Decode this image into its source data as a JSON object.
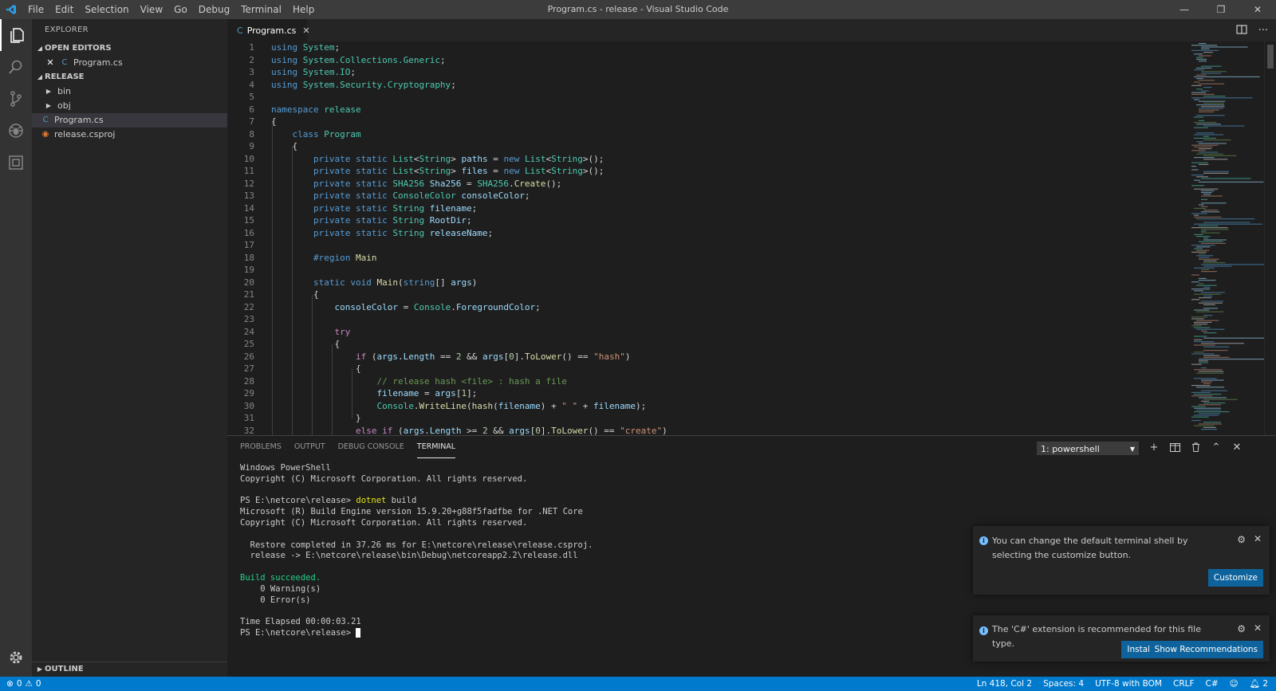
{
  "window": {
    "title": "Program.cs - release - Visual Studio Code"
  },
  "menu": [
    "File",
    "Edit",
    "Selection",
    "View",
    "Go",
    "Debug",
    "Terminal",
    "Help"
  ],
  "sidebar": {
    "title": "EXPLORER",
    "open_editors_label": "OPEN EDITORS",
    "open_editor_file": "Program.cs",
    "folder_label": "RELEASE",
    "items": [
      {
        "label": "bin",
        "type": "folder"
      },
      {
        "label": "obj",
        "type": "folder"
      },
      {
        "label": "Program.cs",
        "type": "cs"
      },
      {
        "label": "release.csproj",
        "type": "rss"
      }
    ],
    "outline_label": "OUTLINE"
  },
  "editor": {
    "tab_label": "Program.cs",
    "line_numbers": [
      "1",
      "2",
      "3",
      "4",
      "5",
      "6",
      "7",
      "8",
      "9",
      "10",
      "11",
      "12",
      "13",
      "14",
      "15",
      "16",
      "17",
      "18",
      "19",
      "20",
      "21",
      "22",
      "23",
      "24",
      "25",
      "26",
      "27",
      "28",
      "29",
      "30",
      "31",
      "32"
    ],
    "code_lines": [
      [
        [
          "kw",
          "using "
        ],
        [
          "ty",
          "System"
        ],
        [
          "",
          "; "
        ]
      ],
      [
        [
          "kw",
          "using "
        ],
        [
          "ty",
          "System.Collections.Generic"
        ],
        [
          "",
          ";"
        ]
      ],
      [
        [
          "kw",
          "using "
        ],
        [
          "ty",
          "System.IO"
        ],
        [
          "",
          ";"
        ]
      ],
      [
        [
          "kw",
          "using "
        ],
        [
          "ty",
          "System.Security.Cryptography"
        ],
        [
          "",
          ";"
        ]
      ],
      [],
      [
        [
          "kw",
          "namespace "
        ],
        [
          "ty",
          "release"
        ]
      ],
      [
        [
          "",
          "{"
        ]
      ],
      [
        [
          "",
          "    "
        ],
        [
          "kw",
          "class "
        ],
        [
          "ty",
          "Program"
        ]
      ],
      [
        [
          "",
          "    {"
        ]
      ],
      [
        [
          "",
          "        "
        ],
        [
          "kw",
          "private static "
        ],
        [
          "ty",
          "List"
        ],
        [
          "",
          "<"
        ],
        [
          "ty",
          "String"
        ],
        [
          "",
          "> "
        ],
        [
          "vr",
          "paths"
        ],
        [
          "",
          " = "
        ],
        [
          "kw",
          "new "
        ],
        [
          "ty",
          "List"
        ],
        [
          "",
          "<"
        ],
        [
          "ty",
          "String"
        ],
        [
          "",
          ">();"
        ]
      ],
      [
        [
          "",
          "        "
        ],
        [
          "kw",
          "private static "
        ],
        [
          "ty",
          "List"
        ],
        [
          "",
          "<"
        ],
        [
          "ty",
          "String"
        ],
        [
          "",
          "> "
        ],
        [
          "vr",
          "files"
        ],
        [
          "",
          " = "
        ],
        [
          "kw",
          "new "
        ],
        [
          "ty",
          "List"
        ],
        [
          "",
          "<"
        ],
        [
          "ty",
          "String"
        ],
        [
          "",
          ">();"
        ]
      ],
      [
        [
          "",
          "        "
        ],
        [
          "kw",
          "private static "
        ],
        [
          "ty",
          "SHA256 "
        ],
        [
          "vr",
          "Sha256"
        ],
        [
          "",
          " = "
        ],
        [
          "ty",
          "SHA256"
        ],
        [
          "",
          "."
        ],
        [
          "fn",
          "Create"
        ],
        [
          "",
          "();"
        ]
      ],
      [
        [
          "",
          "        "
        ],
        [
          "kw",
          "private static "
        ],
        [
          "ty",
          "ConsoleColor "
        ],
        [
          "vr",
          "consoleColor"
        ],
        [
          "",
          ";"
        ]
      ],
      [
        [
          "",
          "        "
        ],
        [
          "kw",
          "private static "
        ],
        [
          "ty",
          "String "
        ],
        [
          "vr",
          "filename"
        ],
        [
          "",
          ";"
        ]
      ],
      [
        [
          "",
          "        "
        ],
        [
          "kw",
          "private static "
        ],
        [
          "ty",
          "String "
        ],
        [
          "vr",
          "RootDir"
        ],
        [
          "",
          ";"
        ]
      ],
      [
        [
          "",
          "        "
        ],
        [
          "kw",
          "private static "
        ],
        [
          "ty",
          "String "
        ],
        [
          "vr",
          "releaseName"
        ],
        [
          "",
          ";"
        ]
      ],
      [],
      [
        [
          "",
          "        "
        ],
        [
          "kw",
          "#region "
        ],
        [
          "fn",
          "Main"
        ]
      ],
      [],
      [
        [
          "",
          "        "
        ],
        [
          "kw",
          "static void "
        ],
        [
          "fn",
          "Main"
        ],
        [
          "",
          "("
        ],
        [
          "kw",
          "string"
        ],
        [
          "",
          "[] "
        ],
        [
          "vr",
          "args"
        ],
        [
          "",
          ")"
        ]
      ],
      [
        [
          "",
          "        {"
        ]
      ],
      [
        [
          "",
          "            "
        ],
        [
          "vr",
          "consoleColor"
        ],
        [
          "",
          " = "
        ],
        [
          "ty",
          "Console"
        ],
        [
          "",
          "."
        ],
        [
          "vr",
          "ForegroundColor"
        ],
        [
          "",
          ";"
        ]
      ],
      [],
      [
        [
          "",
          "            "
        ],
        [
          "ct",
          "try"
        ]
      ],
      [
        [
          "",
          "            {"
        ]
      ],
      [
        [
          "",
          "                "
        ],
        [
          "ct",
          "if "
        ],
        [
          "",
          "("
        ],
        [
          "vr",
          "args"
        ],
        [
          "",
          "."
        ],
        [
          "vr",
          "Length"
        ],
        [
          "",
          " == "
        ],
        [
          "nu",
          "2"
        ],
        [
          "",
          " && "
        ],
        [
          "vr",
          "args"
        ],
        [
          "",
          "["
        ],
        [
          "nu",
          "0"
        ],
        [
          "",
          "]."
        ],
        [
          "fn",
          "ToLower"
        ],
        [
          "",
          "() == "
        ],
        [
          "st",
          "\"hash\""
        ],
        [
          "",
          ")"
        ]
      ],
      [
        [
          "",
          "                {"
        ]
      ],
      [
        [
          "",
          "                    "
        ],
        [
          "cm",
          "// release hash <file> : hash a file"
        ]
      ],
      [
        [
          "",
          "                    "
        ],
        [
          "vr",
          "filename"
        ],
        [
          "",
          " = "
        ],
        [
          "vr",
          "args"
        ],
        [
          "",
          "["
        ],
        [
          "nu",
          "1"
        ],
        [
          "",
          "];"
        ]
      ],
      [
        [
          "",
          "                    "
        ],
        [
          "ty",
          "Console"
        ],
        [
          "",
          "."
        ],
        [
          "fn",
          "WriteLine"
        ],
        [
          "",
          "("
        ],
        [
          "fn",
          "hash"
        ],
        [
          "",
          "("
        ],
        [
          "vr",
          "filename"
        ],
        [
          "",
          ") + "
        ],
        [
          "st",
          "\" \""
        ],
        [
          "",
          " + "
        ],
        [
          "vr",
          "filename"
        ],
        [
          "",
          ");"
        ]
      ],
      [
        [
          "",
          "                }"
        ]
      ],
      [
        [
          "",
          "                "
        ],
        [
          "ct",
          "else if "
        ],
        [
          "",
          "("
        ],
        [
          "vr",
          "args"
        ],
        [
          "",
          "."
        ],
        [
          "vr",
          "Length"
        ],
        [
          "",
          " >= "
        ],
        [
          "nu",
          "2"
        ],
        [
          "",
          " && "
        ],
        [
          "vr",
          "args"
        ],
        [
          "",
          "["
        ],
        [
          "nu",
          "0"
        ],
        [
          "",
          "]."
        ],
        [
          "fn",
          "ToLower"
        ],
        [
          "",
          "() == "
        ],
        [
          "st",
          "\"create\""
        ],
        [
          "",
          ")"
        ]
      ]
    ]
  },
  "panel": {
    "tabs": [
      "PROBLEMS",
      "OUTPUT",
      "DEBUG CONSOLE",
      "TERMINAL"
    ],
    "active_tab": "TERMINAL",
    "terminal_select": "1: powershell",
    "terminal_lines": [
      [
        [
          "",
          "Windows PowerShell"
        ]
      ],
      [
        [
          "",
          "Copyright (C) Microsoft Corporation. All rights reserved."
        ]
      ],
      [
        [
          "",
          ""
        ]
      ],
      [
        [
          "",
          "PS E:\\netcore\\release> "
        ],
        [
          "yl",
          "dotnet"
        ],
        [
          "",
          " build"
        ]
      ],
      [
        [
          "",
          "Microsoft (R) Build Engine version 15.9.20+g88f5fadfbe for .NET Core"
        ]
      ],
      [
        [
          "",
          "Copyright (C) Microsoft Corporation. All rights reserved."
        ]
      ],
      [
        [
          "",
          ""
        ]
      ],
      [
        [
          "",
          "  Restore completed in 37.26 ms for E:\\netcore\\release\\release.csproj."
        ]
      ],
      [
        [
          "",
          "  release -> E:\\netcore\\release\\bin\\Debug\\netcoreapp2.2\\release.dll"
        ]
      ],
      [
        [
          "",
          ""
        ]
      ],
      [
        [
          "gr",
          "Build succeeded."
        ]
      ],
      [
        [
          "",
          "    0 Warning(s)"
        ]
      ],
      [
        [
          "",
          "    0 Error(s)"
        ]
      ],
      [
        [
          "",
          ""
        ]
      ],
      [
        [
          "",
          "Time Elapsed 00:00:03.21"
        ]
      ],
      [
        [
          "",
          "PS E:\\netcore\\release> "
        ]
      ]
    ]
  },
  "notifications": [
    {
      "message": "You can change the default terminal shell by selecting the customize button.",
      "buttons": [
        "Customize"
      ]
    },
    {
      "message": "The 'C#' extension is recommended for this file type.",
      "buttons": [
        "Install",
        "Show Recommendations"
      ]
    }
  ],
  "statusbar": {
    "errors": "0",
    "warnings": "0",
    "position": "Ln 418, Col 2",
    "spaces": "Spaces: 4",
    "encoding": "UTF-8 with BOM",
    "eol": "CRLF",
    "language": "C#",
    "notifications_count": "2"
  },
  "colors": {
    "accent": "#007acc",
    "button": "#0e639c",
    "cs_icon": "#519aba",
    "rss_icon": "#e37933"
  }
}
